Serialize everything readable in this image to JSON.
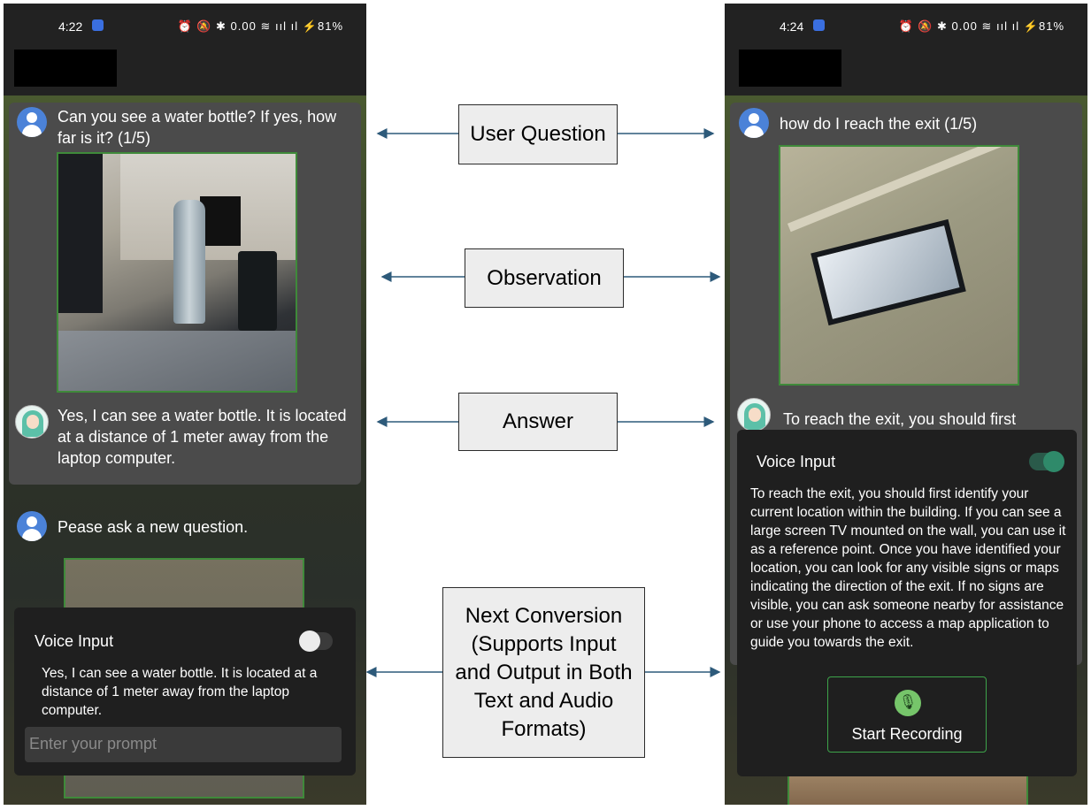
{
  "left_screen": {
    "status": {
      "time": "4:22",
      "icons_text": "⏰ 🔕 ✱ 0.00 ≋ ııl ıl ⚡81%"
    },
    "chat": {
      "q1": "Can you see a water bottle? If yes, how far is it? (1/5)",
      "a1": " Yes, I can see a water bottle. It is located at a distance of 1 meter away from the laptop computer.",
      "q2": "Pease ask a new question."
    },
    "panel": {
      "voice_label": "Voice Input",
      "toggle_on": false,
      "output_text": "Yes, I can see a water bottle. It is located at a distance of 1 meter away from the laptop computer.",
      "prompt_placeholder": "Enter your prompt"
    }
  },
  "right_screen": {
    "status": {
      "time": "4:24",
      "icons_text": "⏰ 🔕 ✱ 0.00 ≋ ııl ıl ⚡81%"
    },
    "chat": {
      "q1": "how do I reach the exit (1/5)",
      "a1_preview": "To reach the exit, you should first"
    },
    "panel": {
      "voice_label": "Voice Input",
      "toggle_on": true,
      "output_text": " To reach the exit, you should first identify your current location within the building. If you can see a large screen TV mounted on the wall, you can use it as a reference point. Once you have identified your location, you can look for any visible signs or maps indicating the direction of the exit. If no signs are visible, you can ask someone nearby for assistance or use your phone to access a map application to guide you towards the exit.",
      "record_label": "Start Recording",
      "mic_icon": "mic-off-icon"
    }
  },
  "callouts": {
    "user_question": "User Question",
    "observation": "Observation",
    "answer": "Answer",
    "next_conversion": "Next Conversion (Supports Input and Output in Both Text and Audio Formats)"
  },
  "colors": {
    "accent_green": "#3da34a",
    "toggle_on": "#2f8a6a",
    "avatar_blue": "#4b82d8"
  }
}
